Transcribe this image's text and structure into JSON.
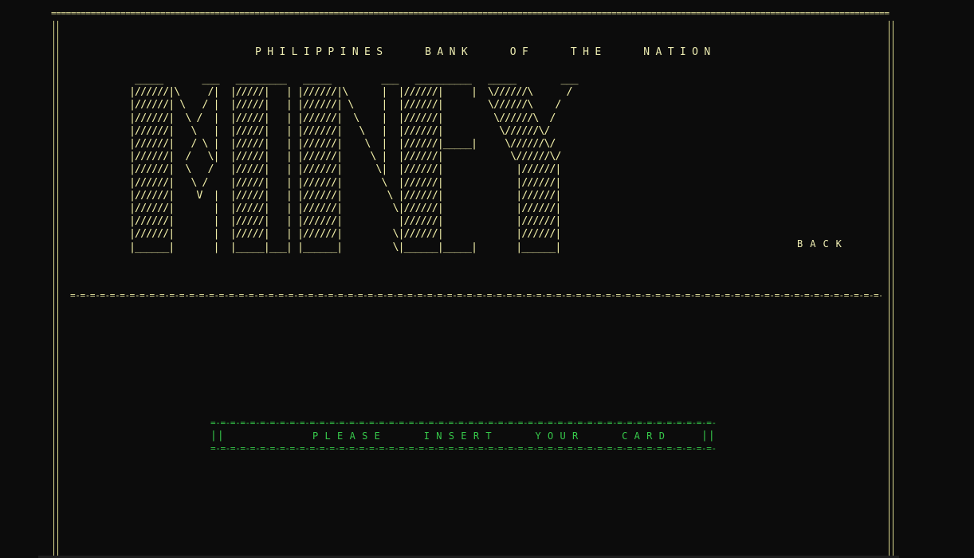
{
  "screen": {
    "bank_name": "PHILIPPINES   BANK   OF   THE   NATION",
    "logo_word": "MONEY",
    "logo_suffix": "BACK",
    "prompt": "PLEASE   INSERT   YOUR   CARD",
    "prompt_border_left": "||",
    "prompt_border_right": "||"
  },
  "ascii_logo": [
    " _____       ___   _________   _____         ___   __________   _____        ___",
    "|//////|\\     /|  |/////|   | |//////|\\      |  |//////|     |  \\//////\\      /",
    "|//////| \\   / |  |/////|   | |//////| \\     |  |//////|        \\//////\\    / ",
    "|//////|  \\ /  |  |/////|   | |//////|  \\    |  |//////|         \\//////\\  /  ",
    "|//////|   \\   |  |/////|   | |//////|   \\   |  |//////|          \\//////\\/   ",
    "|//////|   / \\ |  |/////|   | |//////|    \\  |  |//////|_____|     \\//////\\/  ",
    "|//////|  /   \\|  |/////|   | |//////|     \\ |  |//////|            \\//////\\/ ",
    "|//////|  \\   /   |/////|   | |//////|      \\|  |//////|             |//////| ",
    "|//////|   \\ /    |/////|   | |//////|       \\  |//////|             |//////| ",
    "|//////|    V  |  |/////|   | |//////|        \\ |//////|             |//////| ",
    "|//////|       |  |/////|   | |//////|         \\|//////|             |//////| ",
    "|//////|       |  |/////|   | |//////|          |//////|             |//////| ",
    "|//////|       |  |/////|   | |//////|         \\|//////|             |//////| ",
    "|______|       |  |_____|___| |______|         \\|______|_____|       |______| "
  ],
  "colors": {
    "background": "#0c0c0c",
    "frame": "#e8e6a0",
    "prompt": "#36c84a"
  }
}
